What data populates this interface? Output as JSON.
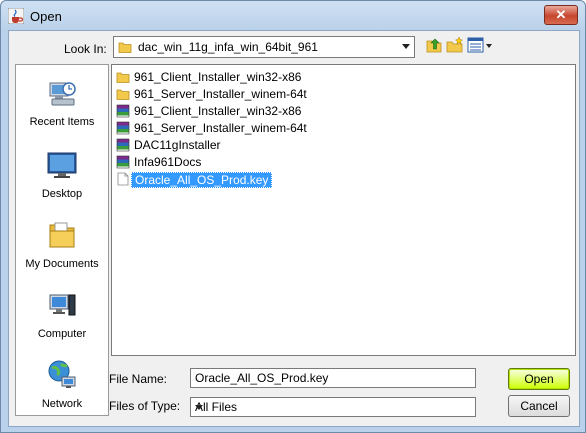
{
  "window": {
    "title": "Open",
    "close_glyph": "✕"
  },
  "look_in": {
    "label": "Look In:",
    "value": "dac_win_11g_infa_win_64bit_961",
    "toolbar": [
      {
        "name": "up-one-level-icon"
      },
      {
        "name": "create-new-folder-icon"
      },
      {
        "name": "view-menu-icon"
      }
    ]
  },
  "places": [
    {
      "label": "Recent Items",
      "icon": "recent-items-icon"
    },
    {
      "label": "Desktop",
      "icon": "desktop-icon"
    },
    {
      "label": "My Documents",
      "icon": "my-documents-icon"
    },
    {
      "label": "Computer",
      "icon": "computer-icon"
    },
    {
      "label": "Network",
      "icon": "network-icon"
    }
  ],
  "files": [
    {
      "name": "961_Client_Installer_win32-x86",
      "icon": "folder-icon",
      "selected": false
    },
    {
      "name": "961_Server_Installer_winem-64t",
      "icon": "folder-icon",
      "selected": false
    },
    {
      "name": "961_Client_Installer_win32-x86",
      "icon": "archive-icon",
      "selected": false
    },
    {
      "name": "961_Server_Installer_winem-64t",
      "icon": "archive-icon",
      "selected": false
    },
    {
      "name": "DAC11gInstaller",
      "icon": "archive-icon",
      "selected": false
    },
    {
      "name": "Infa961Docs",
      "icon": "archive-icon",
      "selected": false
    },
    {
      "name": "Oracle_All_OS_Prod.key",
      "icon": "document-icon",
      "selected": true
    }
  ],
  "file_name": {
    "label": "File Name:",
    "value": "Oracle_All_OS_Prod.key"
  },
  "files_of_type": {
    "label": "Files of Type:",
    "value": "All Files"
  },
  "buttons": {
    "open": "Open",
    "cancel": "Cancel"
  },
  "colors": {
    "selection": "#3399ff",
    "open_button": "#ccff00",
    "title_bar": "#b9d1ea"
  }
}
